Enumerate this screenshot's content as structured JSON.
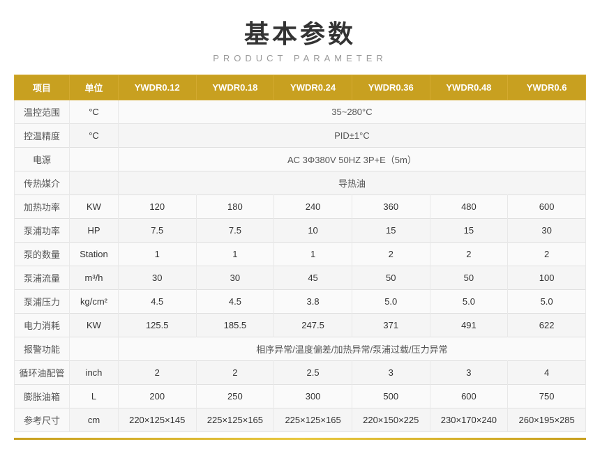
{
  "title": "基本参数",
  "subtitle": "PRODUCT PARAMETER",
  "headers": {
    "item": "项目",
    "unit": "单位",
    "col1": "YWDR0.12",
    "col2": "YWDR0.18",
    "col3": "YWDR0.24",
    "col4": "YWDR0.36",
    "col5": "YWDR0.48",
    "col6": "YWDR0.6"
  },
  "rows": [
    {
      "name": "温控范围",
      "unit": "°C",
      "span": true,
      "spanValue": "35~280°C"
    },
    {
      "name": "控温精度",
      "unit": "°C",
      "span": true,
      "spanValue": "PID±1°C"
    },
    {
      "name": "电源",
      "unit": "",
      "span": true,
      "spanValue": "AC 3Φ380V 50HZ 3P+E（5m）"
    },
    {
      "name": "传热媒介",
      "unit": "",
      "span": true,
      "spanValue": "导热油"
    },
    {
      "name": "加热功率",
      "unit": "KW",
      "span": false,
      "values": [
        "120",
        "180",
        "240",
        "360",
        "480",
        "600"
      ]
    },
    {
      "name": "泵浦功率",
      "unit": "HP",
      "span": false,
      "values": [
        "7.5",
        "7.5",
        "10",
        "15",
        "15",
        "30"
      ]
    },
    {
      "name": "泵的数量",
      "unit": "Station",
      "span": false,
      "values": [
        "1",
        "1",
        "1",
        "2",
        "2",
        "2"
      ]
    },
    {
      "name": "泵浦流量",
      "unit": "m³/h",
      "span": false,
      "values": [
        "30",
        "30",
        "45",
        "50",
        "50",
        "100"
      ]
    },
    {
      "name": "泵浦压力",
      "unit": "kg/cm²",
      "span": false,
      "values": [
        "4.5",
        "4.5",
        "3.8",
        "5.0",
        "5.0",
        "5.0"
      ]
    },
    {
      "name": "电力消耗",
      "unit": "KW",
      "span": false,
      "values": [
        "125.5",
        "185.5",
        "247.5",
        "371",
        "491",
        "622"
      ]
    },
    {
      "name": "报警功能",
      "unit": "",
      "span": true,
      "spanValue": "相序异常/温度偏差/加热异常/泵浦过载/压力异常"
    },
    {
      "name": "循环油配管",
      "unit": "inch",
      "span": false,
      "values": [
        "2",
        "2",
        "2.5",
        "3",
        "3",
        "4"
      ]
    },
    {
      "name": "膨胀油箱",
      "unit": "L",
      "span": false,
      "values": [
        "200",
        "250",
        "300",
        "500",
        "600",
        "750"
      ]
    },
    {
      "name": "参考尺寸",
      "unit": "cm",
      "span": false,
      "values": [
        "220×125×145",
        "225×125×165",
        "225×125×165",
        "220×150×225",
        "230×170×240",
        "260×195×285"
      ]
    }
  ]
}
